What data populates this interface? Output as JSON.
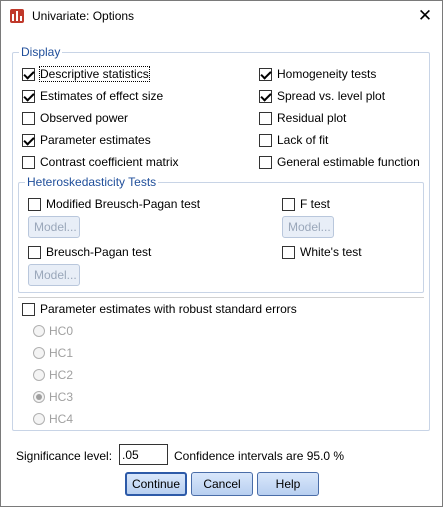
{
  "window": {
    "title": "Univariate: Options",
    "close_glyph": "✕"
  },
  "display": {
    "legend": "Display",
    "left_options": [
      {
        "label": "Descriptive statistics",
        "checked": true
      },
      {
        "label": "Estimates of effect size",
        "checked": true
      },
      {
        "label": "Observed power",
        "checked": false
      },
      {
        "label": "Parameter estimates",
        "checked": true
      },
      {
        "label": "Contrast coefficient matrix",
        "checked": false
      }
    ],
    "right_options": [
      {
        "label": "Homogeneity tests",
        "checked": true
      },
      {
        "label": "Spread vs. level plot",
        "checked": true
      },
      {
        "label": "Residual plot",
        "checked": false
      },
      {
        "label": "Lack of fit",
        "checked": false
      },
      {
        "label": "General estimable function",
        "checked": false
      }
    ]
  },
  "heteroskedasticity": {
    "legend": "Heteroskedasticity Tests",
    "modified_bp": {
      "label": "Modified Breusch-Pagan test",
      "checked": false
    },
    "f_test": {
      "label": "F test",
      "checked": false
    },
    "bp": {
      "label": "Breusch-Pagan test",
      "checked": false
    },
    "white": {
      "label": "White's test",
      "checked": false
    },
    "model_label": "Model..."
  },
  "robust": {
    "label": "Parameter estimates with robust standard errors",
    "checked": false,
    "options": [
      {
        "label": "HC0",
        "selected": false
      },
      {
        "label": "HC1",
        "selected": false
      },
      {
        "label": "HC2",
        "selected": false
      },
      {
        "label": "HC3",
        "selected": true
      },
      {
        "label": "HC4",
        "selected": false
      }
    ]
  },
  "significance": {
    "label": "Significance level:",
    "value": ".05",
    "ci_text": "Confidence intervals are 95.0 %"
  },
  "buttons": {
    "continue": "Continue",
    "cancel": "Cancel",
    "help": "Help"
  }
}
